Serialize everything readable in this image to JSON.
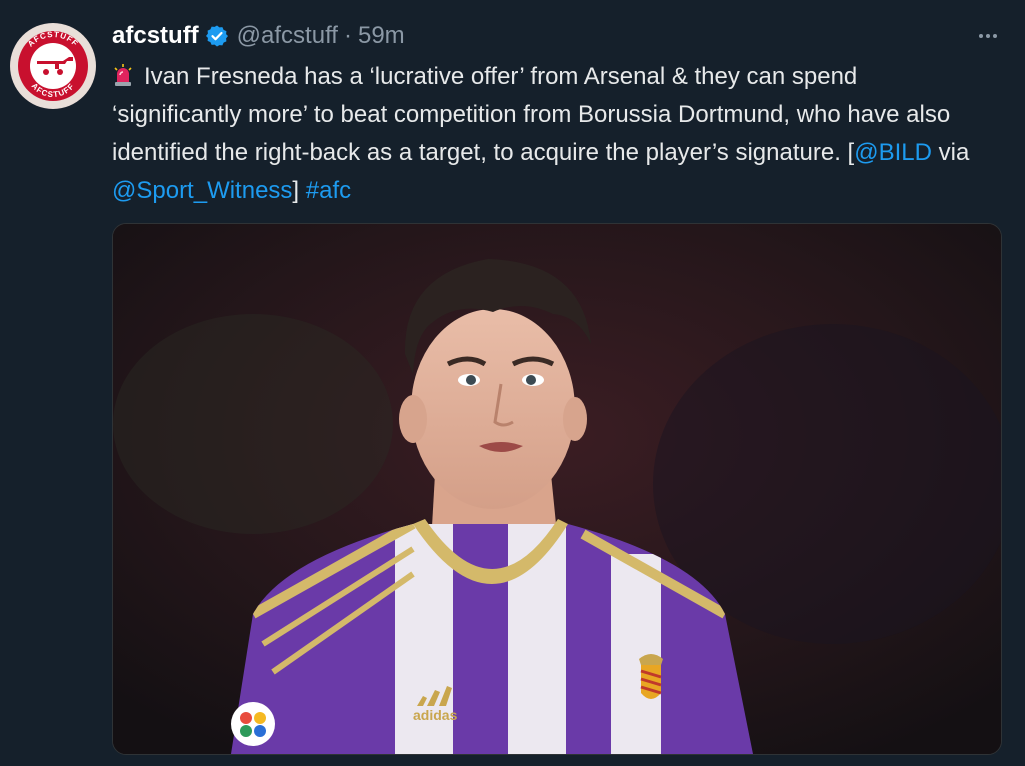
{
  "tweet": {
    "display_name": "afcstuff",
    "verified_icon": "verified-badge-icon",
    "handle": "@afcstuff",
    "separator": "·",
    "timestamp": "59m",
    "more_icon": "more-options-icon",
    "avatar": {
      "icon": "afcstuff-logo",
      "logo_text_top": "AFCSTUFF",
      "logo_text_bottom": "AFCSTUFF",
      "colors": {
        "ring": "#c8102e",
        "inner": "#ffffff"
      }
    },
    "text": {
      "emoji": "police-light-icon",
      "part1": "Ivan Fresneda has a ‘lucrative offer’ from Arsenal & they can spend ‘significantly more’ to beat competition from Borussia Dortmund, who have also identified the right-back as a target, to acquire the player’s signature. [",
      "mention1": "@BILD",
      "part2": " via ",
      "mention2": "@Sport_Witness",
      "part3": "] ",
      "hashtag": "#afc"
    },
    "media": {
      "description_icon": "player-photo",
      "kit_brand": "adidas",
      "colors": {
        "kit_purple": "#6a3aa8",
        "kit_stripe": "#ece8f0",
        "trim": "#d4b96a"
      }
    }
  },
  "colors": {
    "background": "#15202b",
    "text": "#e7e9ea",
    "muted": "#8b98a5",
    "link": "#1d9bf0",
    "verified": "#1d9bf0"
  }
}
